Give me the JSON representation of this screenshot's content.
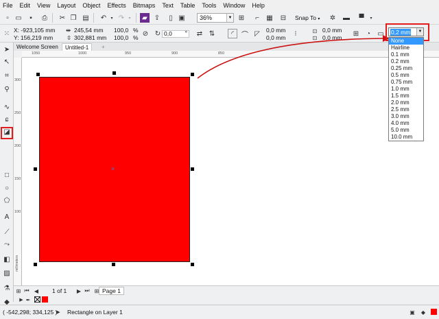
{
  "menu": [
    "File",
    "Edit",
    "View",
    "Layout",
    "Object",
    "Effects",
    "Bitmaps",
    "Text",
    "Table",
    "Tools",
    "Window",
    "Help"
  ],
  "toolbar": {
    "zoom": "36%",
    "snap_to": "Snap To"
  },
  "properties": {
    "x": "X: -923,105 mm",
    "y": "Y: 156,219 mm",
    "width": "245,54 mm",
    "height": "302,881 mm",
    "scale_x": "100,0",
    "scale_y": "100,0",
    "percent": "%",
    "rotation": "0,0",
    "degree": "°",
    "corner1": "0,0 mm",
    "corner2": "0,0 mm",
    "corner3": "0,0 mm",
    "corner4": "0,0 mm"
  },
  "tabs": [
    "Welcome Screen",
    "Untitled-1",
    "+"
  ],
  "ruler_h": [
    "1050",
    "1000",
    "950",
    "900",
    "850"
  ],
  "ruler_v": [
    "300",
    "250",
    "200",
    "150",
    "100"
  ],
  "outline": {
    "selected": "0,2 mm",
    "options": [
      "None",
      "Hairline",
      "0.1 mm",
      "0.2 mm",
      "0.25 mm",
      "0.5 mm",
      "0.75 mm",
      "1.0 mm",
      "1.5 mm",
      "2.0 mm",
      "2.5 mm",
      "3.0 mm",
      "4.0 mm",
      "5.0 mm",
      "10.0 mm"
    ],
    "highlighted_index": 0
  },
  "page": {
    "counter": "1 of 1",
    "tab": "Page 1"
  },
  "ruler_unit": "millimeters",
  "status": {
    "coords": "( -542,298; 334,125 )",
    "info": "Rectangle on Layer 1"
  },
  "colors": {
    "fill": "#ff0000",
    "accent": "#e31b1b",
    "highlight": "#3399ff"
  }
}
